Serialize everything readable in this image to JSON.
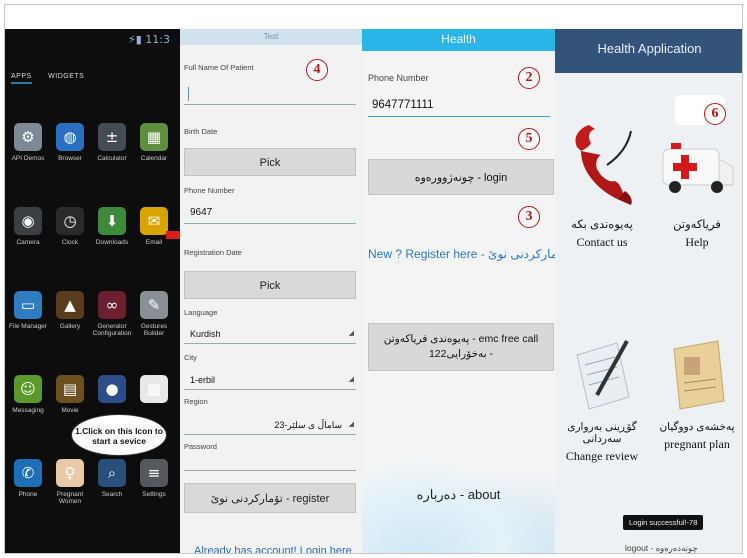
{
  "launcher": {
    "status": "⚡▮ 11:3",
    "tabs": [
      "APPS",
      "WIDGETS"
    ],
    "apps": [
      {
        "label": "API Demos",
        "glyph": "⚙",
        "color": "#7d8a96"
      },
      {
        "label": "Browser",
        "glyph": "◍",
        "color": "#2a6fc0"
      },
      {
        "label": "Calculator",
        "glyph": "±",
        "color": "#444b52"
      },
      {
        "label": "Calendar",
        "glyph": "▦",
        "color": "#5f8f3e"
      },
      {
        "label": "Camera",
        "glyph": "◉",
        "color": "#3b3f44"
      },
      {
        "label": "Clock",
        "glyph": "◷",
        "color": "#2a2a2a"
      },
      {
        "label": "Downloads",
        "glyph": "⬇",
        "color": "#3e8a3a"
      },
      {
        "label": "Email",
        "glyph": "✉",
        "color": "#d9a400"
      },
      {
        "label": "File Manager",
        "glyph": "▭",
        "color": "#2f7cc0"
      },
      {
        "label": "Gallery",
        "glyph": "▲",
        "color": "#5a3d1f"
      },
      {
        "label": "Generator Configuration",
        "glyph": "∞",
        "color": "#6b2030"
      },
      {
        "label": "Gestures Builder",
        "glyph": "✎",
        "color": "#8a8f96"
      },
      {
        "label": "Messaging",
        "glyph": "☺",
        "color": "#5b9a2a"
      },
      {
        "label": "Movie",
        "glyph": "▤",
        "color": "#6d5020"
      },
      {
        "label": "",
        "glyph": "●",
        "color": "#2b4e8a"
      },
      {
        "label": "",
        "glyph": "▦",
        "color": "#e8e8e8"
      },
      {
        "label": "Phone",
        "glyph": "✆",
        "color": "#1f6fb8"
      },
      {
        "label": "Pregnant Women",
        "glyph": "♀",
        "color": "#e8c9a8"
      },
      {
        "label": "Search",
        "glyph": "⌕",
        "color": "#2a4f7a"
      },
      {
        "label": "Settings",
        "glyph": "≡",
        "color": "#55585c"
      }
    ],
    "tip": "1.Click on this Icon to start a sevice"
  },
  "register": {
    "topbar": "Test",
    "badge": "4",
    "fields": {
      "name_label": "Full Name Of Patient",
      "name_value": "",
      "birth_label": "Birth Date",
      "pick": "Pick",
      "phone_label": "Phone Number",
      "phone_value": "9647",
      "regdate_label": "Registration Date",
      "pick2": "Pick",
      "language_label": "Language",
      "language_value": "Kurdish",
      "city_label": "City",
      "city_value": "1-erbil",
      "region_label": "Region",
      "region_value": "23-ساماڵ ی سلێر",
      "password_label": "Password",
      "password_value": ""
    },
    "register_button": "تۆمارکردنی نوێ - register",
    "login_link": "Already has account! Login here"
  },
  "login": {
    "title": "Health",
    "phone_label": "Phone Number",
    "phone_value": "9647771111",
    "badge_phone": "2",
    "badge_login": "5",
    "login_button": "چونەژوورەوە - login",
    "badge_register": "3",
    "register_link": "New ? Register here - تۆمارکردنی نوێ",
    "emc_button": "پەیوەندی فریاکەوتن - emc free call 122بەخۆرایی -",
    "about_button": "دەربارە - about"
  },
  "home": {
    "title": "Health Application",
    "badge": "6",
    "tiles": [
      {
        "ku": "پەیوەندی بکە",
        "en": "Contact us"
      },
      {
        "ku": "فریاکەوتن",
        "en": "Help"
      },
      {
        "ku": "گۆڕینی بەرواری سەردانی",
        "en": "Change review"
      },
      {
        "ku": "پەخشەی دووگیان",
        "en": "pregnant plan"
      }
    ],
    "toast": "Login successful!-78",
    "logout": "logout - چونەدەرەوە"
  }
}
